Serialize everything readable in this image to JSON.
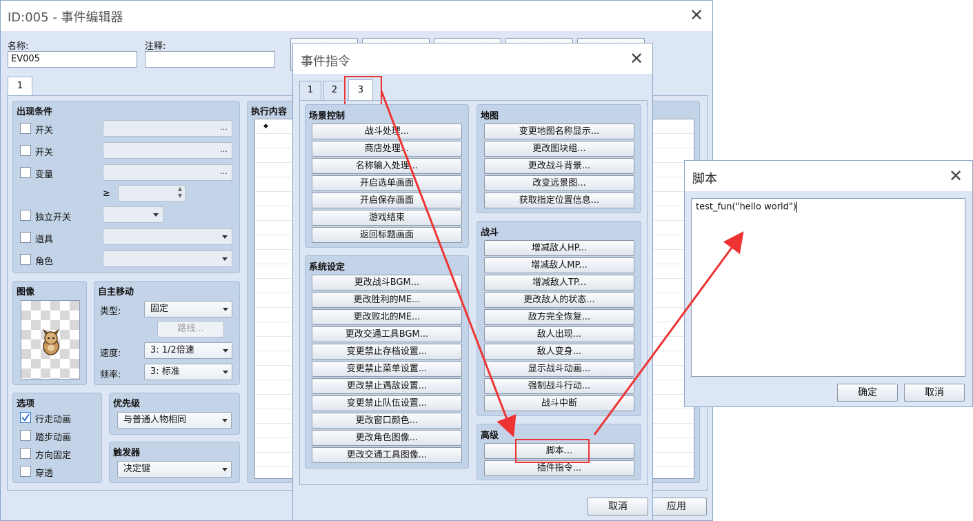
{
  "main_window": {
    "title": "ID:005 - 事件编辑器",
    "name_label": "名称:",
    "name_value": "EV005",
    "note_label": "注释:",
    "note_value": "",
    "page_tab": "1",
    "conditions": {
      "title": "出现条件",
      "switch1": "开关",
      "switch2": "开关",
      "variable": "变量",
      "gte": "≥",
      "self_switch": "独立开关",
      "item": "道具",
      "actor": "角色",
      "ellipsis": "…"
    },
    "image_title": "图像",
    "autonomous": {
      "title": "自主移动",
      "type_label": "类型:",
      "type_value": "固定",
      "route_button": "路线...",
      "speed_label": "速度:",
      "speed_value": "3: 1/2倍速",
      "freq_label": "频率:",
      "freq_value": "3: 标准"
    },
    "options": {
      "title": "选项",
      "walk": "行走动画",
      "step": "踏步动画",
      "dir_fix": "方向固定",
      "through": "穿透",
      "walk_checked": true
    },
    "priority": {
      "title": "优先级",
      "value": "与普通人物相同"
    },
    "trigger": {
      "title": "触发器",
      "value": "决定键"
    },
    "contents_title": "执行内容",
    "contents_first": "◆",
    "apply_button": "应用"
  },
  "event_commands": {
    "title": "事件指令",
    "tabs": [
      "1",
      "2",
      "3"
    ],
    "active_tab": "3",
    "scene_control": {
      "title": "场景控制",
      "items": [
        "战斗处理...",
        "商店处理...",
        "名称输入处理...",
        "开启选单画面",
        "开启保存画面",
        "游戏结束",
        "返回标题画面"
      ]
    },
    "system_settings": {
      "title": "系统设定",
      "items": [
        "更改战斗BGM...",
        "更改胜利的ME...",
        "更改败北的ME...",
        "更改交通工具BGM...",
        "变更禁止存档设置...",
        "变更禁止菜单设置...",
        "更改禁止遇敌设置...",
        "变更禁止队伍设置...",
        "更改窗口颜色...",
        "更改角色图像...",
        "更改交通工具图像..."
      ]
    },
    "map": {
      "title": "地图",
      "items": [
        "变更地图名称显示...",
        "更改图块组...",
        "更改战斗背景...",
        "改变远景图...",
        "获取指定位置信息..."
      ]
    },
    "battle": {
      "title": "战斗",
      "items": [
        "增减敌人HP...",
        "增减敌人MP...",
        "增减敌人TP...",
        "更改敌人的状态...",
        "敌方完全恢复...",
        "敌人出现...",
        "敌人变身...",
        "显示战斗动画...",
        "强制战斗行动...",
        "战斗中断"
      ]
    },
    "advanced": {
      "title": "高级",
      "items": [
        "脚本...",
        "插件指令..."
      ]
    },
    "cancel_button": "取消"
  },
  "script_dialog": {
    "title": "脚本",
    "code": "test_fun(\"hello world\")",
    "ok_button": "确定",
    "cancel_button": "取消"
  },
  "colors": {
    "window_bg": "#dce6f4",
    "panel_bg": "#c4d4e8",
    "annotation_red": "#ee3333"
  }
}
